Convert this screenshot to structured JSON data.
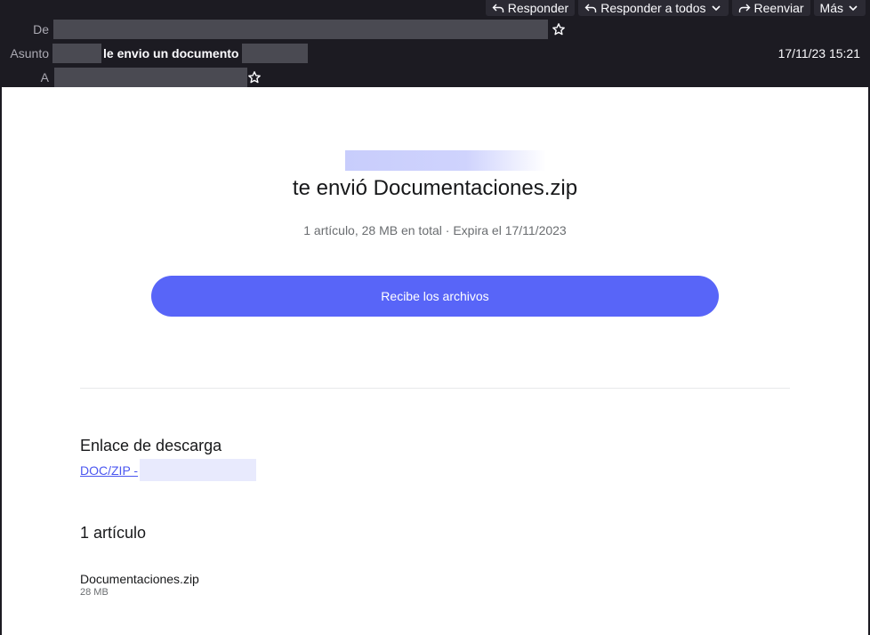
{
  "toolbar": {
    "reply": "Responder",
    "reply_all": "Responder a todos",
    "forward": "Reenviar",
    "more": "Más"
  },
  "header": {
    "from_label": "De",
    "subject_label": "Asunto",
    "subject_text": "le envio un documento",
    "to_label": "A",
    "date": "17/11/23 15:21"
  },
  "message": {
    "title": "te envió Documentaciones.zip",
    "meta": "1 artículo, 28 MB en total · Expira el 17/11/2023",
    "button_label": "Recibe los archivos",
    "download_heading": "Enlace de descarga",
    "download_link": "DOC/ZIP -",
    "items_heading": "1 artículo",
    "file_name": "Documentaciones.zip",
    "file_size": "28 MB"
  },
  "colors": {
    "accent": "#5865f8",
    "link": "#4b57f0",
    "header_bg": "#1c1b22"
  }
}
